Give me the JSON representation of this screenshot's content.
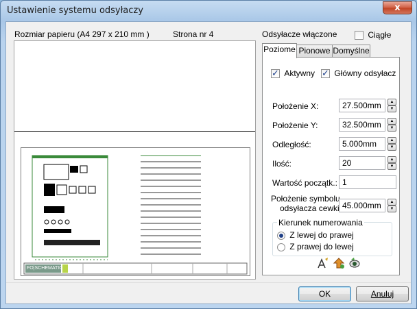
{
  "window": {
    "title": "Ustawienie systemu odsyłaczy",
    "close_glyph": "x"
  },
  "preview": {
    "paper_label": "Rozmiar papieru (A4 297 x 210 mm )",
    "page_label": "Strona nr 4",
    "logo_text": "FO|SCHEMATIC"
  },
  "settings": {
    "header_label": "Odsyłacze włączone",
    "continuous_label": "Ciągłe",
    "continuous_checked": false,
    "tabs": [
      {
        "label": "Poziome",
        "active": true
      },
      {
        "label": "Pionowe",
        "active": false
      },
      {
        "label": "Domyślne",
        "active": false
      }
    ],
    "active_checkbox": {
      "label": "Aktywny",
      "checked": true
    },
    "main_ref_checkbox": {
      "label": "Główny odsyłacz",
      "checked": true
    },
    "fields": {
      "pos_x": {
        "label": "Położenie X:",
        "value": "27.500mm"
      },
      "pos_y": {
        "label": "Położenie Y:",
        "value": "32.500mm"
      },
      "distance": {
        "label": "Odległość:",
        "value": "5.000mm"
      },
      "count": {
        "label": "Ilość:",
        "value": "20"
      },
      "start_value": {
        "label": "Wartość początk.:",
        "value": "1"
      },
      "symbol_pos": {
        "label_line1": "Położenie symbolu",
        "label_line2": "odsyłacza cewki",
        "value": "45.000mm"
      }
    },
    "numbering": {
      "title": "Kierunek numerowania",
      "left_to_right": "Z lewej do prawej",
      "right_to_left": "Z prawej do lewej",
      "selected": "left_to_right"
    },
    "tool_icons": [
      "text-style-icon",
      "move-up-icon",
      "view-eye-icon"
    ]
  },
  "buttons": {
    "ok": "OK",
    "cancel": "Anuluj"
  },
  "colors": {
    "title_gradient": "#a9c7e7",
    "close_red": "#c04323",
    "client_bg": "#f0f0f0"
  }
}
